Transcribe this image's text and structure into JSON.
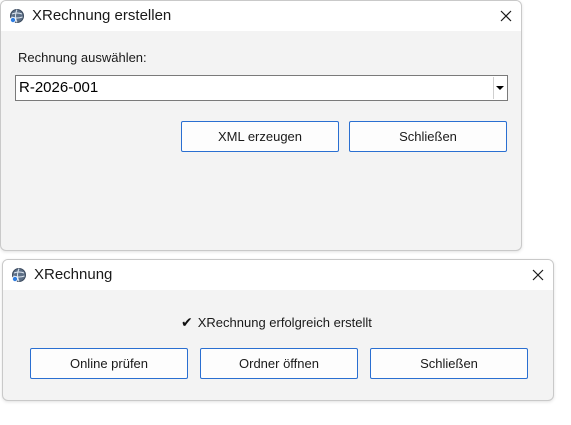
{
  "dialog1": {
    "title": "XRechnung erstellen",
    "label": "Rechnung auswählen:",
    "select_value": "R-2026-001",
    "buttons": {
      "generate": "XML erzeugen",
      "close": "Schließen"
    }
  },
  "dialog2": {
    "title": "XRechnung",
    "status_icon": "✔",
    "status_text": "XRechnung erfolgreich erstellt",
    "buttons": {
      "validate": "Online prüfen",
      "open_folder": "Ordner öffnen",
      "close": "Schließen"
    }
  },
  "colors": {
    "accent": "#2a6fd1",
    "window_bg": "#f3f3f3",
    "titlebar_bg": "#ffffff"
  },
  "icons": {
    "app": "globe-app-icon",
    "close": "close-icon",
    "dropdown": "dropdown-arrow-icon",
    "status": "checkmark-icon"
  }
}
